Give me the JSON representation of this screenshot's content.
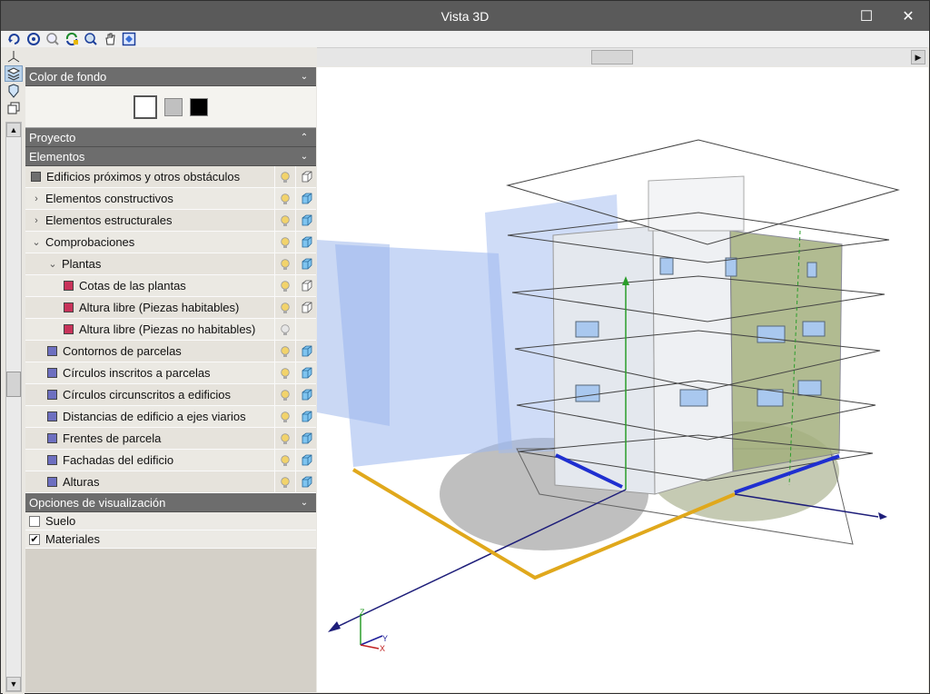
{
  "window": {
    "title": "Vista 3D",
    "minimize": "—",
    "maximize": "☐",
    "close": "✕"
  },
  "panel": {
    "background": {
      "title": "Color de fondo",
      "swatches": [
        "#ffffff",
        "#c0c0c0",
        "#000000"
      ]
    },
    "project": {
      "title": "Proyecto"
    },
    "elements": {
      "title": "Elementos",
      "items": [
        {
          "label": "Edificios próximos y otros obstáculos",
          "color": "#6e6e6e",
          "indent": 0,
          "expander": "",
          "bulb": "on",
          "view": "wire"
        },
        {
          "label": "Elementos constructivos",
          "color": "",
          "indent": 0,
          "expander": "›",
          "bulb": "on",
          "view": "solid"
        },
        {
          "label": "Elementos estructurales",
          "color": "",
          "indent": 0,
          "expander": "›",
          "bulb": "on",
          "view": "solid"
        },
        {
          "label": "Comprobaciones",
          "color": "",
          "indent": 0,
          "expander": "⌄",
          "bulb": "on",
          "view": "solid"
        },
        {
          "label": "Plantas",
          "color": "",
          "indent": 1,
          "expander": "⌄",
          "bulb": "on",
          "view": "solid"
        },
        {
          "label": "Cotas de las plantas",
          "color": "#c8335a",
          "indent": 2,
          "expander": "",
          "bulb": "on",
          "view": "wire"
        },
        {
          "label": "Altura libre (Piezas habitables)",
          "color": "#c8335a",
          "indent": 2,
          "expander": "",
          "bulb": "on",
          "view": "wire"
        },
        {
          "label": "Altura libre (Piezas no habitables)",
          "color": "#c8335a",
          "indent": 2,
          "expander": "",
          "bulb": "off",
          "view": "none"
        },
        {
          "label": "Contornos de parcelas",
          "color": "#6d6fc0",
          "indent": 1,
          "expander": "",
          "bulb": "on",
          "view": "solid"
        },
        {
          "label": "Círculos inscritos a parcelas",
          "color": "#6d6fc0",
          "indent": 1,
          "expander": "",
          "bulb": "on",
          "view": "solid"
        },
        {
          "label": "Círculos circunscritos a edificios",
          "color": "#6d6fc0",
          "indent": 1,
          "expander": "",
          "bulb": "on",
          "view": "solid"
        },
        {
          "label": "Distancias de edificio a ejes viarios",
          "color": "#6d6fc0",
          "indent": 1,
          "expander": "",
          "bulb": "on",
          "view": "solid"
        },
        {
          "label": "Frentes de parcela",
          "color": "#6d6fc0",
          "indent": 1,
          "expander": "",
          "bulb": "on",
          "view": "solid"
        },
        {
          "label": "Fachadas del edificio",
          "color": "#6d6fc0",
          "indent": 1,
          "expander": "",
          "bulb": "on",
          "view": "solid"
        },
        {
          "label": "Alturas",
          "color": "#6d6fc0",
          "indent": 1,
          "expander": "",
          "bulb": "on",
          "view": "solid"
        }
      ]
    },
    "options": {
      "title": "Opciones de visualización",
      "items": [
        {
          "label": "Suelo",
          "checked": false
        },
        {
          "label": "Materiales",
          "checked": true
        }
      ]
    }
  },
  "axes": {
    "x": "X",
    "y": "Y",
    "z": "Z"
  }
}
